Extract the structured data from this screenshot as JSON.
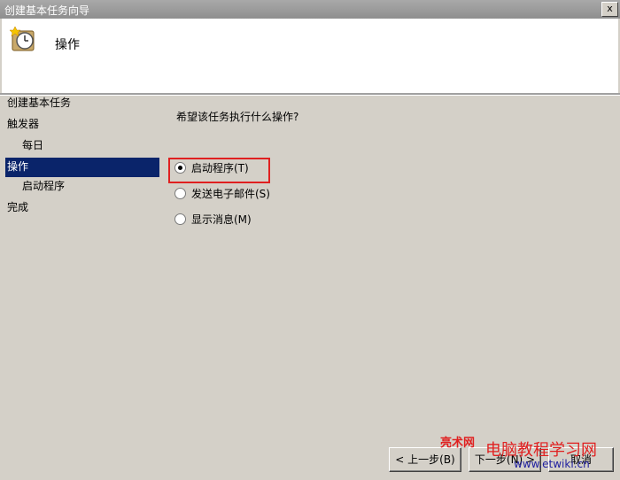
{
  "window": {
    "title": "创建基本任务向导",
    "close_glyph": "x"
  },
  "header": {
    "step_title": "操作",
    "icon": "scheduled-task-clock-icon"
  },
  "nav": {
    "items": [
      {
        "label": "创建基本任务",
        "sub": false,
        "active": false
      },
      {
        "label": "触发器",
        "sub": false,
        "active": false
      },
      {
        "label": "每日",
        "sub": true,
        "active": false
      },
      {
        "label": "操作",
        "sub": false,
        "active": true
      },
      {
        "label": "启动程序",
        "sub": true,
        "active": false
      },
      {
        "label": "完成",
        "sub": false,
        "active": false
      }
    ]
  },
  "main": {
    "question": "希望该任务执行什么操作?",
    "options": [
      {
        "label": "启动程序(T)",
        "checked": true
      },
      {
        "label": "发送电子邮件(S)",
        "checked": false
      },
      {
        "label": "显示消息(M)",
        "checked": false
      }
    ]
  },
  "buttons": {
    "back": "< 上一步(B)",
    "next": "下一步(N) >",
    "cancel": "取消"
  },
  "watermark": {
    "site1": "亮术网",
    "site2": "电脑教程学习网",
    "url": "www.etwiki.cn"
  },
  "colors": {
    "nav_active": "#0a246a",
    "highlight": "#e02020",
    "watermark": "#e02020"
  }
}
